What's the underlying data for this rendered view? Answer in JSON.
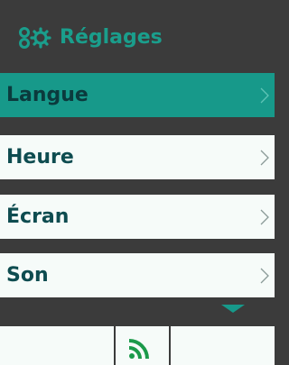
{
  "header": {
    "title": "Réglages",
    "icon": "settings-gears-icon"
  },
  "menu": {
    "items": [
      {
        "label": "Langue",
        "selected": true
      },
      {
        "label": "Heure",
        "selected": false
      },
      {
        "label": "Écran",
        "selected": false
      },
      {
        "label": "Son",
        "selected": false
      }
    ]
  },
  "footer": {
    "icon": "wifi-icon"
  },
  "colors": {
    "background": "#3b3b3b",
    "accent": "#17998a",
    "item_background": "#f6fbf9",
    "label_text": "#0e4c50"
  }
}
